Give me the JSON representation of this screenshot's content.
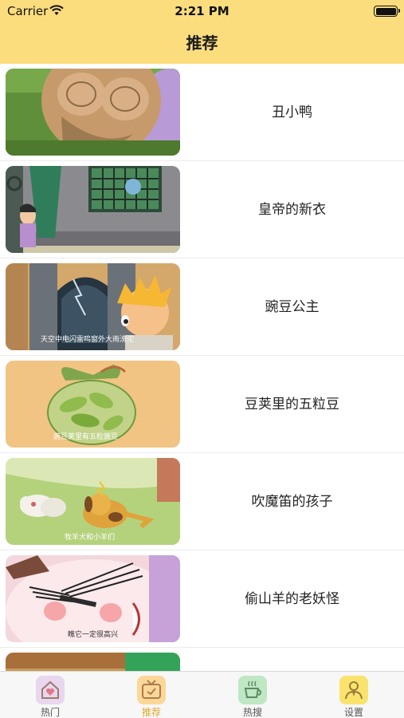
{
  "status_bar": {
    "carrier": "Carrier",
    "time": "2:21 PM"
  },
  "nav": {
    "title": "推荐"
  },
  "stories": [
    {
      "title": "丑小鸭"
    },
    {
      "title": "皇帝的新衣"
    },
    {
      "title": "豌豆公主",
      "caption": "天空中电闪雷鸣窗外大雨滂沱"
    },
    {
      "title": "豆荚里的五粒豆",
      "caption": "豌豆荚里有五粒豌豆"
    },
    {
      "title": "吹魔笛的孩子",
      "caption": "牧羊犬和小羊们"
    },
    {
      "title": "偷山羊的老妖怪",
      "caption": "瞧它一定很高兴"
    }
  ],
  "tabs": [
    {
      "label": "热门",
      "icon": "house-heart-icon",
      "color": "#e8d7ee"
    },
    {
      "label": "推荐",
      "icon": "tv-icon",
      "color": "#fbd89a"
    },
    {
      "label": "热搜",
      "icon": "coffee-cup-icon",
      "color": "#bfe7c4"
    },
    {
      "label": "设置",
      "icon": "person-icon",
      "color": "#f9e36d"
    }
  ],
  "colors": {
    "header": "#fcdd7d",
    "tab_active": "#e0a72c"
  }
}
